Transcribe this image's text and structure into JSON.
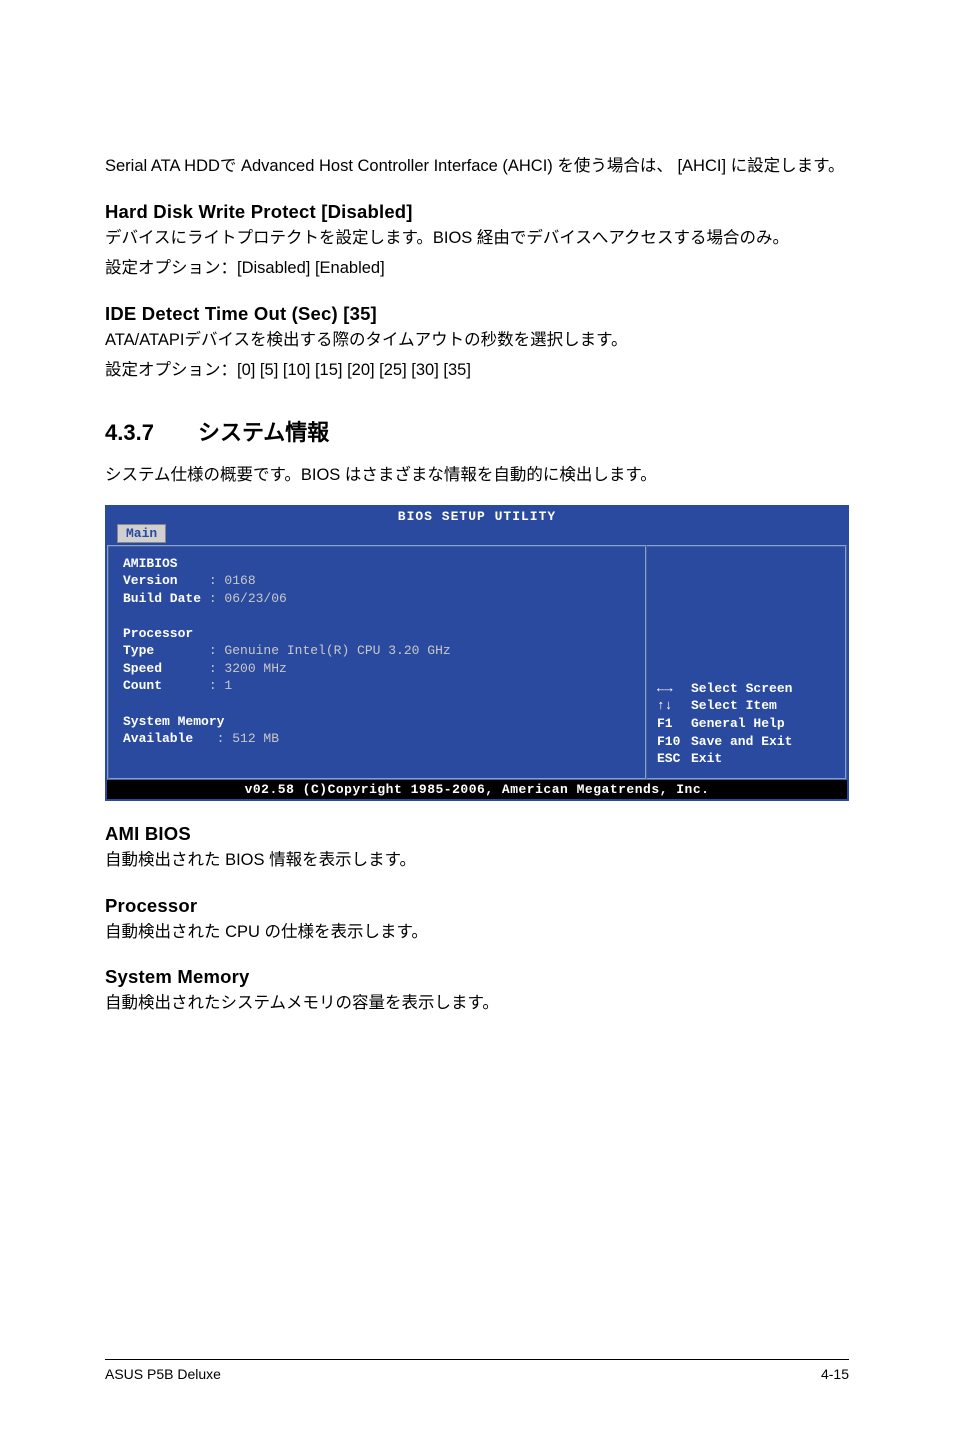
{
  "intro_para": "Serial ATA HDDで Advanced Host Controller Interface (AHCI) を使う場合は、 [AHCI] に設定します。",
  "hdwp": {
    "heading": "Hard Disk Write Protect [Disabled]",
    "line1": "デバイスにライトプロテクトを設定します。BIOS 経由でデバイスへアクセスする場合のみ。",
    "line2": "設定オプション：[Disabled] [Enabled]"
  },
  "ide": {
    "heading": "IDE Detect Time Out (Sec) [35]",
    "line1": "ATA/ATAPIデバイスを検出する際のタイムアウトの秒数を選択します。",
    "line2": "設定オプション：[0] [5] [10] [15] [20] [25] [30] [35]"
  },
  "section": {
    "num": "4.3.7",
    "title": "システム情報",
    "intro": "システム仕様の概要です。BIOS はさまざまな情報を自動的に検出します。"
  },
  "bios": {
    "title": "BIOS SETUP UTILITY",
    "tab": "Main",
    "amibios_label": "AMIBIOS",
    "version_label": "Version",
    "version_val": ": 0168",
    "build_label": "Build Date",
    "build_val": ": 06/23/06",
    "proc_label": "Processor",
    "type_label": "Type",
    "type_val": ": Genuine Intel(R) CPU 3.20 GHz",
    "speed_label": "Speed",
    "speed_val": ": 3200 MHz",
    "count_label": "Count",
    "count_val": ": 1",
    "mem_label": "System Memory",
    "avail_label": "Available",
    "avail_val": ": 512 MB",
    "hint_arrows": "←→",
    "hint_select_screen": "Select Screen",
    "hint_updown": "↑↓",
    "hint_select_item": "Select Item",
    "hint_f1": "F1",
    "hint_general": "General Help",
    "hint_f10": "F10",
    "hint_save": "Save and Exit",
    "hint_esc": "ESC",
    "hint_exit": "Exit",
    "footer": "v02.58 (C)Copyright 1985-2006, American Megatrends, Inc."
  },
  "amibios_sec": {
    "heading": "AMI BIOS",
    "body": "自動検出された BIOS 情報を表示します。"
  },
  "proc_sec": {
    "heading": "Processor",
    "body": "自動検出された CPU の仕様を表示します。"
  },
  "mem_sec": {
    "heading": "System Memory",
    "body": "自動検出されたシステムメモリの容量を表示します。"
  },
  "footer": {
    "left": "ASUS P5B Deluxe",
    "right": "4-15"
  }
}
